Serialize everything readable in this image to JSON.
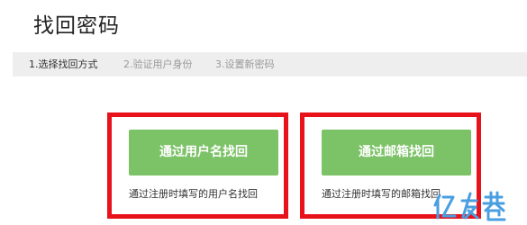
{
  "page": {
    "title": "找回密码"
  },
  "steps": [
    {
      "label": "1.选择找回方式",
      "state": "active"
    },
    {
      "label": "2.验证用户身份",
      "state": "inactive"
    },
    {
      "label": "3.设置新密码",
      "state": "inactive"
    }
  ],
  "options": [
    {
      "button_label": "通过用户名找回",
      "description": "通过注册时填写的用户名找回"
    },
    {
      "button_label": "通过邮箱找回",
      "description": "通过注册时填写的邮箱找回"
    }
  ],
  "watermark": {
    "text": "亿友巷"
  },
  "colors": {
    "highlight_border": "#e8121b",
    "button_green": "#7cc267",
    "steps_background": "#eeeeee",
    "watermark_blue": "#4a9fe0"
  }
}
